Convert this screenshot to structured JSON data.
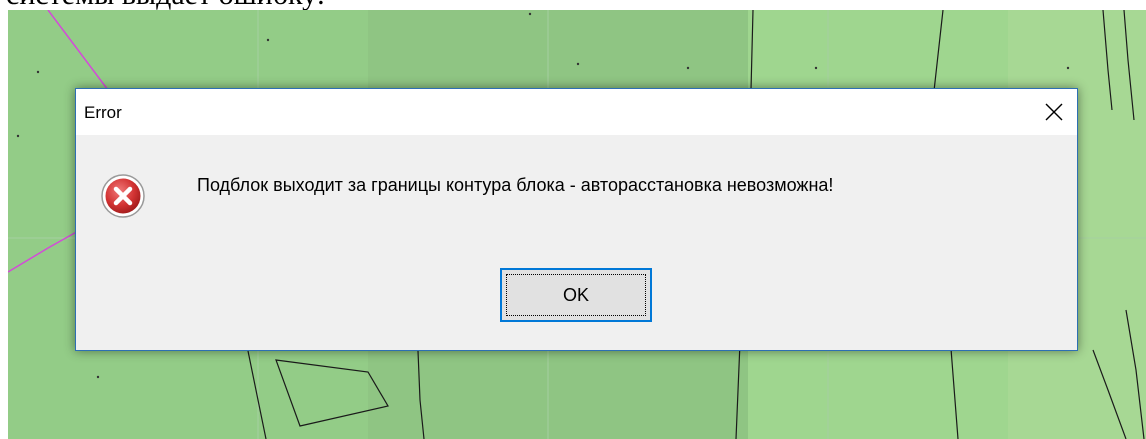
{
  "document": {
    "caption": "системы выдает ошибку:"
  },
  "dialog": {
    "title": "Error",
    "close_icon": "close-icon",
    "message_icon": "error-icon",
    "message": "Подблок выходит за границы контура блока - авторасстановка невозможна!",
    "ok_label": "OK"
  },
  "colors": {
    "map_green": "#93cc87",
    "dialog_border": "#2d6fb3",
    "button_focus": "#0078d7",
    "error_red": "#d23333"
  }
}
